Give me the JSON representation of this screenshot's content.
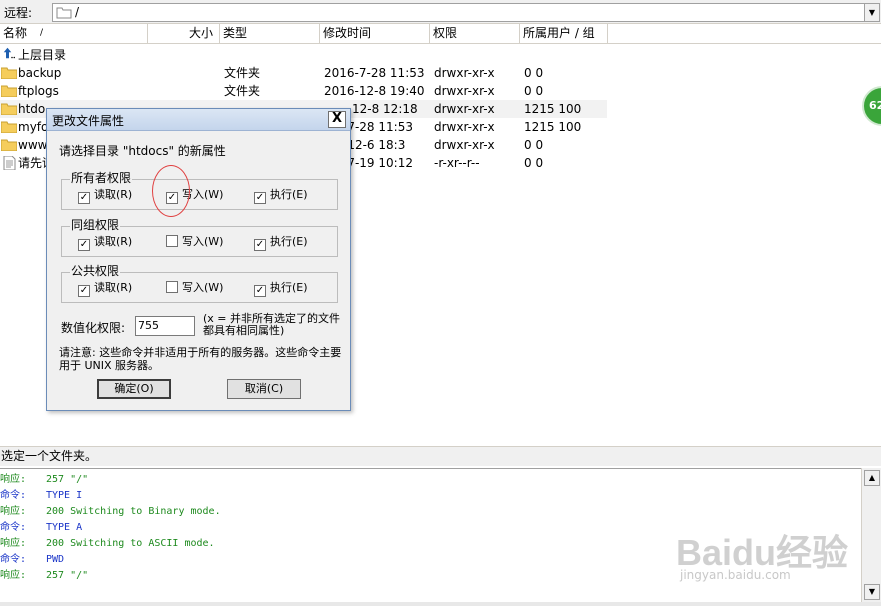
{
  "remote": {
    "label": "远程:",
    "path": "/"
  },
  "columns": {
    "name": "名称",
    "size": "大小",
    "type": "类型",
    "modified": "修改时间",
    "perms": "权限",
    "owner": "所属用户 / 组",
    "sort_indicator": "/"
  },
  "parent_row": {
    "label": "上层目录"
  },
  "files": [
    {
      "name": "backup",
      "type": "文件夹",
      "modified": "2016-7-28 11:53",
      "perms": "drwxr-xr-x",
      "owner": "0 0"
    },
    {
      "name": "ftplogs",
      "type": "文件夹",
      "modified": "2016-12-8 19:40",
      "perms": "drwxr-xr-x",
      "owner": "0 0"
    },
    {
      "name": "htdo",
      "type": "",
      "modified": "12-8 12:18",
      "perms": "drwxr-xr-x",
      "owner": "1215 100"
    },
    {
      "name": "myfo",
      "type": "",
      "modified": "-7-28 11:53",
      "perms": "drwxr-xr-x",
      "owner": "1215 100"
    },
    {
      "name": "www",
      "type": "",
      "modified": "-12-6 18:3",
      "perms": "drwxr-xr-x",
      "owner": "0 0"
    },
    {
      "name": "请先读",
      "type": "",
      "modified": "-7-19 10:12",
      "perms": "-r-xr--r--",
      "owner": "0 0"
    }
  ],
  "badge": "62",
  "status": "选定一个文件夹。",
  "dialog": {
    "title": "更改文件属性",
    "close": "X",
    "prompt": "请选择目录 \"htdocs\" 的新属性",
    "groups": [
      {
        "title": "所有者权限",
        "read": "读取(R)",
        "write": "写入(W)",
        "exec": "执行(E)",
        "read_checked": true,
        "write_checked": true,
        "exec_checked": true
      },
      {
        "title": "同组权限",
        "read": "读取(R)",
        "write": "写入(W)",
        "exec": "执行(E)",
        "read_checked": true,
        "write_checked": false,
        "exec_checked": true
      },
      {
        "title": "公共权限",
        "read": "读取(R)",
        "write": "写入(W)",
        "exec": "执行(E)",
        "read_checked": true,
        "write_checked": false,
        "exec_checked": true
      }
    ],
    "numeric_label": "数值化权限:",
    "numeric_value": "755",
    "numeric_note": "(x = 并非所有选定了的文件都具有相同属性)",
    "notice": "请注意: 这些命令并非适用于所有的服务器。这些命令主要用于 UNIX 服务器。",
    "ok": "确定(O)",
    "cancel": "取消(C)"
  },
  "log": [
    {
      "tag": "响应:",
      "text": "257 \"/\"",
      "kind": "resp"
    },
    {
      "tag": "命令:",
      "text": "TYPE I",
      "kind": "cmd"
    },
    {
      "tag": "响应:",
      "text": "200 Switching to Binary mode.",
      "kind": "resp"
    },
    {
      "tag": "命令:",
      "text": "TYPE A",
      "kind": "cmd"
    },
    {
      "tag": "响应:",
      "text": "200 Switching to ASCII mode.",
      "kind": "resp"
    },
    {
      "tag": "命令:",
      "text": "PWD",
      "kind": "cmd"
    },
    {
      "tag": "响应:",
      "text": "257 \"/\"",
      "kind": "resp"
    }
  ],
  "watermark": {
    "logo": "Baidu经验",
    "url": "jingyan.baidu.com"
  },
  "colors": {
    "cmd": "#1a35c8",
    "resp": "#1e8a1e",
    "dialog_border": "#6b8cb8"
  }
}
